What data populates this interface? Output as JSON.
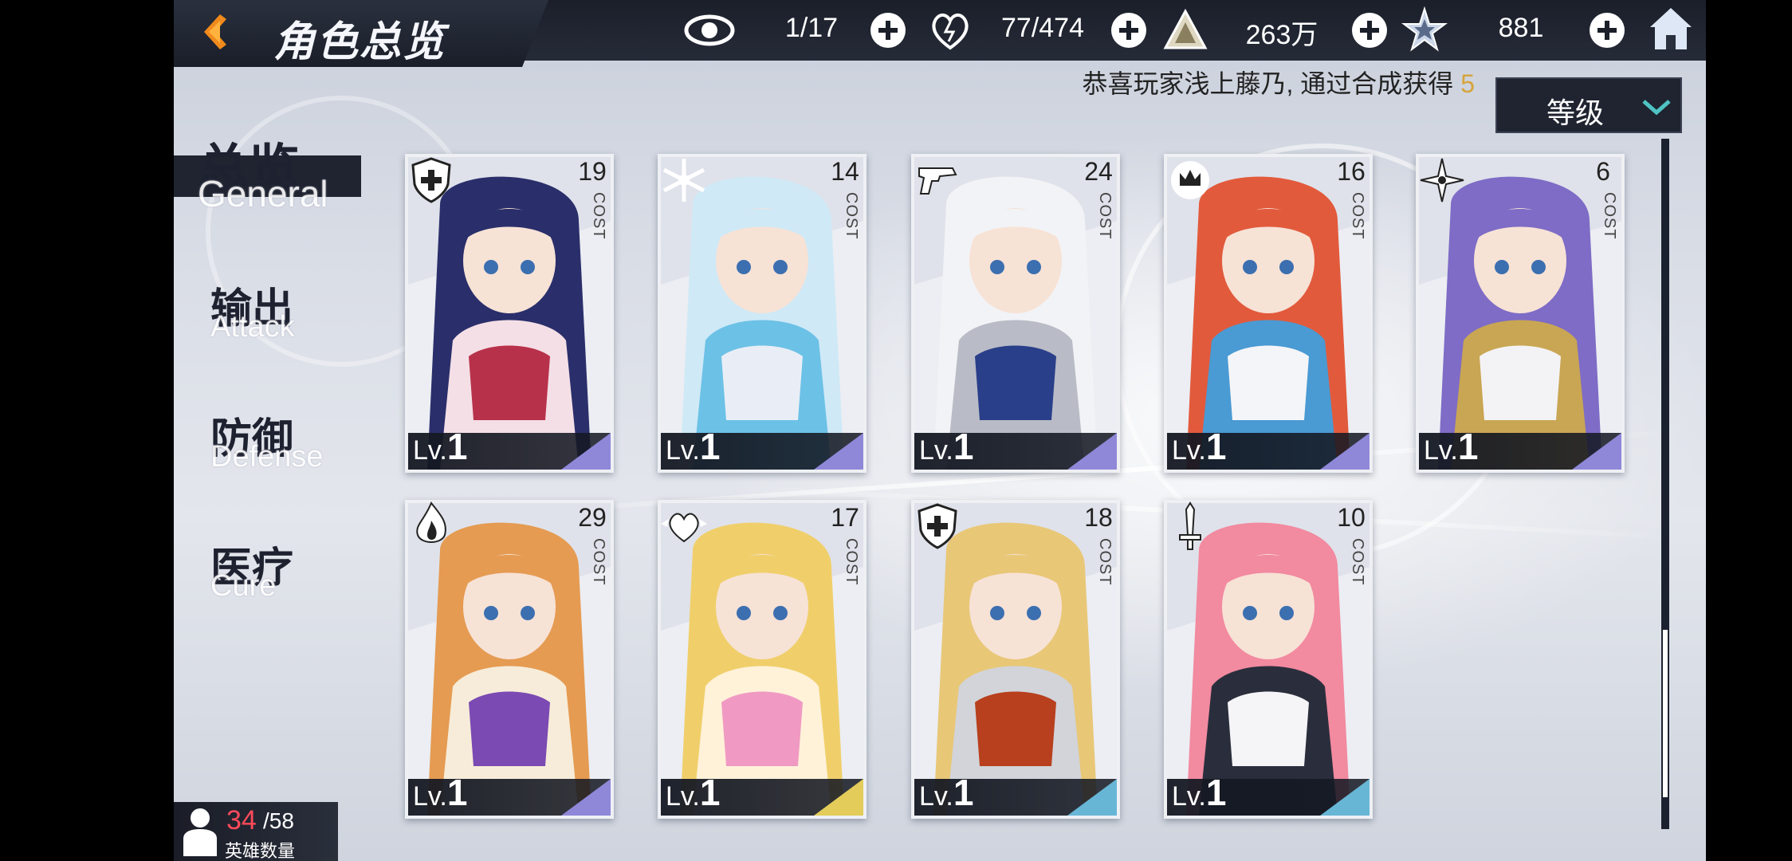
{
  "header": {
    "title": "角色总览",
    "resources": [
      {
        "icon": "eye-icon",
        "value": "1/17"
      },
      {
        "icon": "heart-icon",
        "value": "77/474"
      },
      {
        "icon": "gold-triangle-icon",
        "value": "263万"
      },
      {
        "icon": "star-crystal-icon",
        "value": "881"
      }
    ]
  },
  "marquee": {
    "text": "恭喜玩家浅上藤乃, 通过合成获得",
    "highlight": "5"
  },
  "sort": {
    "selected": "等级"
  },
  "tabs": [
    {
      "cn": "总览",
      "en": "General",
      "active": true
    },
    {
      "cn": "输出",
      "en": "Attack",
      "active": false
    },
    {
      "cn": "防御",
      "en": "Defense",
      "active": false
    },
    {
      "cn": "医疗",
      "en": "Cure",
      "active": false
    }
  ],
  "cost_label": "COST",
  "level_prefix": "Lv.",
  "cards": [
    {
      "cost": "19",
      "level": "1",
      "icon": "shield-cross-icon",
      "rarity_color": "#8f88d8",
      "palette": [
        "#2a2f6b",
        "#b8314a",
        "#f4dfe6"
      ]
    },
    {
      "cost": "14",
      "level": "1",
      "icon": "snowflake-icon",
      "rarity_color": "#8f88d8",
      "palette": [
        "#cfe9f6",
        "#e9eef6",
        "#6cc1e6"
      ]
    },
    {
      "cost": "24",
      "level": "1",
      "icon": "gun-icon",
      "rarity_color": "#8f88d8",
      "palette": [
        "#f2f3f6",
        "#2a3f8a",
        "#b9bcc6"
      ]
    },
    {
      "cost": "16",
      "level": "1",
      "icon": "crown-cross-icon",
      "rarity_color": "#8f88d8",
      "palette": [
        "#e25a3c",
        "#f4f5f8",
        "#4a9ad3"
      ]
    },
    {
      "cost": "6",
      "level": "1",
      "icon": "shuriken-icon",
      "rarity_color": "#8f88d8",
      "palette": [
        "#7e6cc6",
        "#f3f3f6",
        "#c9a653"
      ]
    },
    {
      "cost": "29",
      "level": "1",
      "icon": "flame-icon",
      "rarity_color": "#8f88d8",
      "palette": [
        "#e59b52",
        "#7b4ab3",
        "#f7ecd9"
      ]
    },
    {
      "cost": "17",
      "level": "1",
      "icon": "heart-wings-icon",
      "rarity_color": "#e3cc5a",
      "palette": [
        "#f0cf6b",
        "#f09ac3",
        "#fff2d9"
      ]
    },
    {
      "cost": "18",
      "level": "1",
      "icon": "shield-cross-icon",
      "rarity_color": "#67b6d6",
      "palette": [
        "#e8c777",
        "#b8401e",
        "#d2d4da"
      ]
    },
    {
      "cost": "10",
      "level": "1",
      "icon": "sword-icon",
      "rarity_color": "#67b6d6",
      "palette": [
        "#f28aa0",
        "#f5f5f8",
        "#2a2e3c"
      ]
    }
  ],
  "hero_count": {
    "current": "34",
    "total": "/58",
    "label": "英雄数量"
  }
}
